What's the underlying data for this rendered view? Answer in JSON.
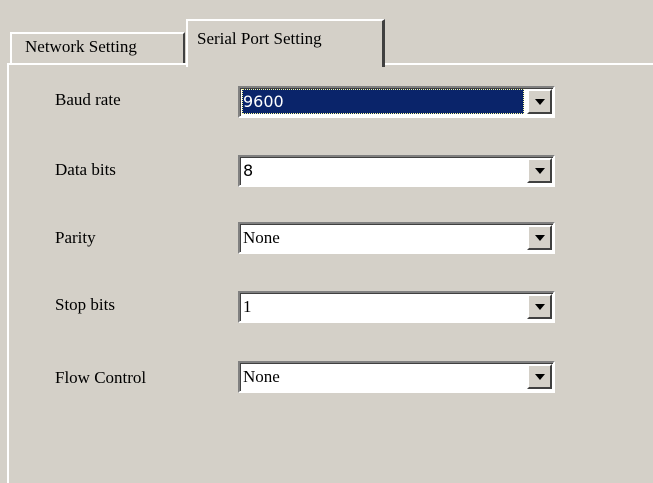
{
  "tabs": [
    {
      "label": "Network Setting",
      "active": false
    },
    {
      "label": "Serial Port Setting",
      "active": true
    }
  ],
  "settings": [
    {
      "label": "Baud rate",
      "value": "9600",
      "selected": true
    },
    {
      "label": "Data bits",
      "value": "8",
      "selected": false
    },
    {
      "label": "Parity",
      "value": "None",
      "selected": false
    },
    {
      "label": "Stop bits",
      "value": "1",
      "selected": false
    },
    {
      "label": "Flow Control",
      "value": "None",
      "selected": false
    }
  ],
  "icons": {
    "dropdown": "chevron-down-icon"
  },
  "colors": {
    "background": "#d4d0c8",
    "selection": "#0a246a",
    "field": "#ffffff"
  }
}
